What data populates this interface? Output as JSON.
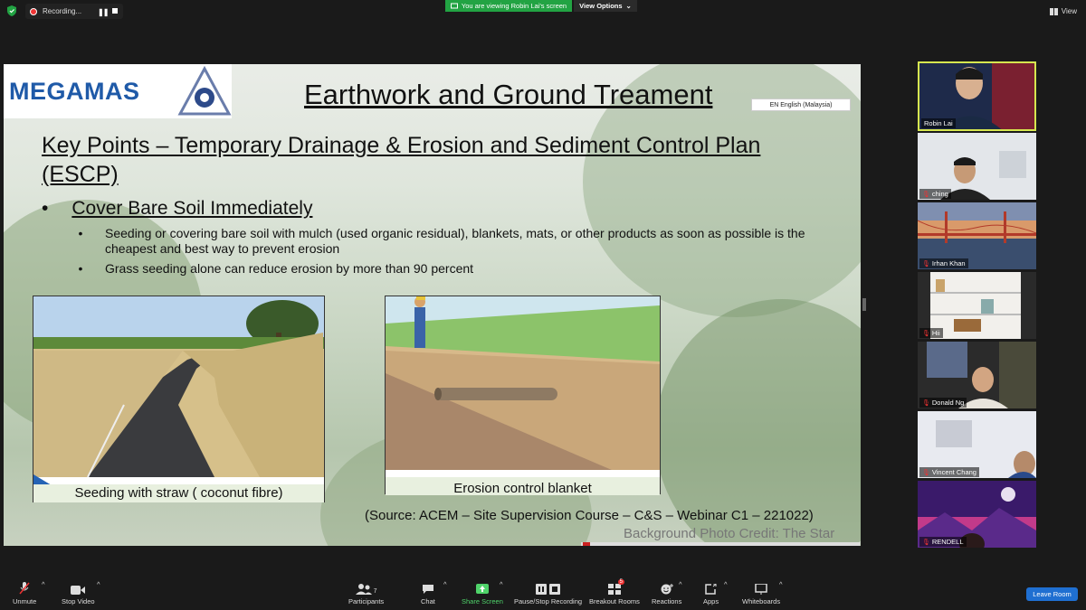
{
  "topbar": {
    "recording_label": "Recording...",
    "viewing_banner": "You are viewing Robin Lai's screen",
    "view_options": "View Options",
    "view_label": "View"
  },
  "slide": {
    "logo_text": "MEGAMAS",
    "title": "Earthwork and Ground Treament",
    "language_chip": "EN English (Malaysia)",
    "key_points": "Key Points – Temporary Drainage & Erosion and Sediment Control Plan (ESCP)",
    "bullet_main": "Cover Bare Soil Immediately",
    "bullet_symbol": "•",
    "sub_bullets": [
      "Seeding or covering bare soil with mulch (used organic residual), blankets, mats, or other products as soon as possible is the cheapest and best way to prevent erosion",
      "Grass seeding alone can reduce erosion by more than 90 percent"
    ],
    "image1_caption": "Seeding with straw ( coconut fibre)",
    "image2_caption": "Erosion control blanket",
    "source": "(Source: ACEM – Site Supervision Course – C&S – Webinar C1 – 221022)",
    "credit": "Background Photo Credit: The Star"
  },
  "participants": [
    {
      "name": "Robin Lai",
      "muted": false,
      "active": true
    },
    {
      "name": "ching",
      "muted": true,
      "active": false
    },
    {
      "name": "Irhan Khan",
      "muted": true,
      "active": false
    },
    {
      "name": "Hii",
      "muted": true,
      "active": false
    },
    {
      "name": "Donald Ng",
      "muted": true,
      "active": false
    },
    {
      "name": "Vincent Chang",
      "muted": true,
      "active": false
    },
    {
      "name": "RENDELL",
      "muted": true,
      "active": false
    }
  ],
  "toolbar": {
    "unmute": "Unmute",
    "stop_video": "Stop Video",
    "participants": "Participants",
    "participants_count": "7",
    "chat": "Chat",
    "share_screen": "Share Screen",
    "pause_recording": "Pause/Stop Recording",
    "breakout_rooms": "Breakout Rooms",
    "breakout_badge": "5",
    "reactions": "Reactions",
    "apps": "Apps",
    "whiteboards": "Whiteboards",
    "leave": "Leave Room"
  },
  "colors": {
    "share_green": "#4fd36a",
    "viewing_green": "#22a343",
    "leave_blue": "#1f6fd1",
    "active_border": "#d6e64f",
    "logo_blue": "#1f5aa8"
  }
}
